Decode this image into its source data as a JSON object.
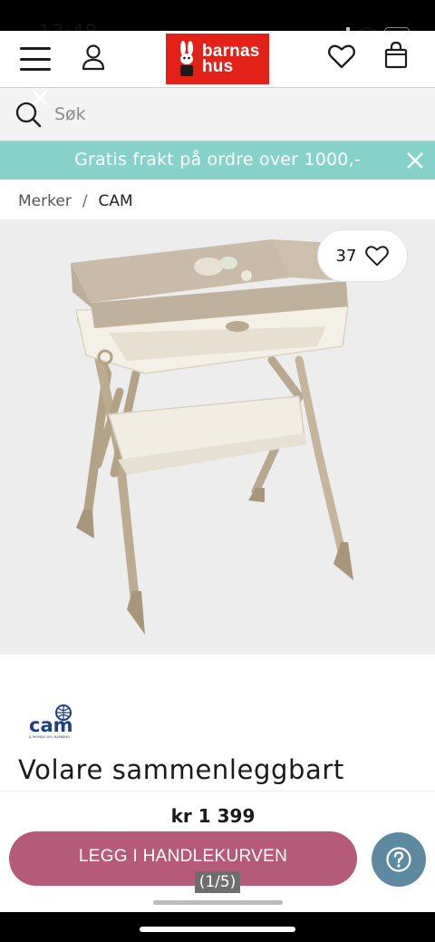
{
  "status_bar": {
    "time": "13:48"
  },
  "header": {
    "logo_line1": "barnas",
    "logo_line2": "hus",
    "brand_color": "#e32119"
  },
  "search": {
    "placeholder": "Søk"
  },
  "promo": {
    "text": "Gratis frakt på ordre over 1000,-",
    "color": "#86d1c9"
  },
  "breadcrumb": {
    "items": [
      "Merker",
      "CAM"
    ],
    "separator": "/"
  },
  "product": {
    "favorites_count": "37",
    "brand_logo_text": "cam",
    "brand_logo_tagline": "IL MONDO DEL BAMBINO",
    "title": "Volare sammenleggbart",
    "price": "kr 1 399"
  },
  "actions": {
    "add_to_cart_label": "LEGG I HANDLEKURVEN",
    "add_to_cart_color": "#b65a79",
    "help_color": "#5e8aa1"
  },
  "pager": {
    "text": "(1/5)"
  }
}
